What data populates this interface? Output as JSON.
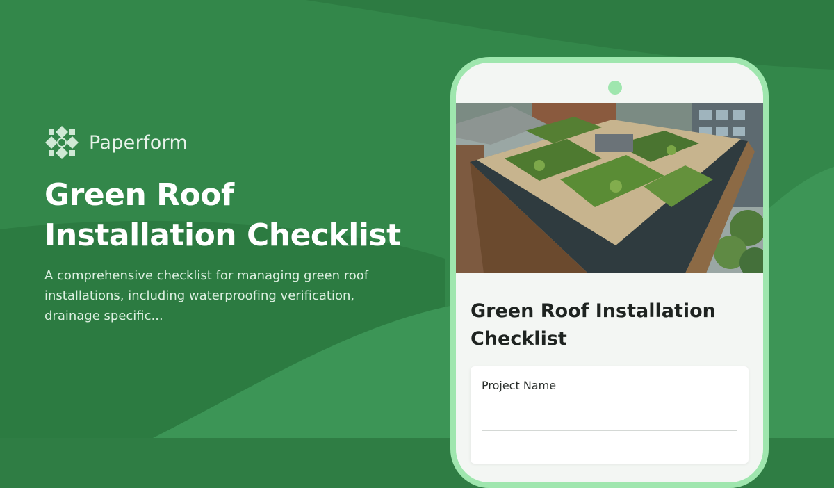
{
  "brand": {
    "name": "Paperform",
    "logo_icon": "paperform-logo-icon"
  },
  "hero": {
    "title": "Green Roof Installation Checklist",
    "description": "A comprehensive checklist for managing green roof installations, including waterproofing verification, drainage specific..."
  },
  "form_preview": {
    "image_icon": "green-roof-building-photo",
    "title": "Green Roof Installation Checklist",
    "fields": [
      {
        "label": "Project Name",
        "value": "",
        "placeholder": ""
      }
    ]
  },
  "colors": {
    "background": "#2f7d44",
    "phone_frame": "#9fe6ae",
    "phone_screen": "#f3f6f3",
    "title_text": "#ffffff"
  }
}
